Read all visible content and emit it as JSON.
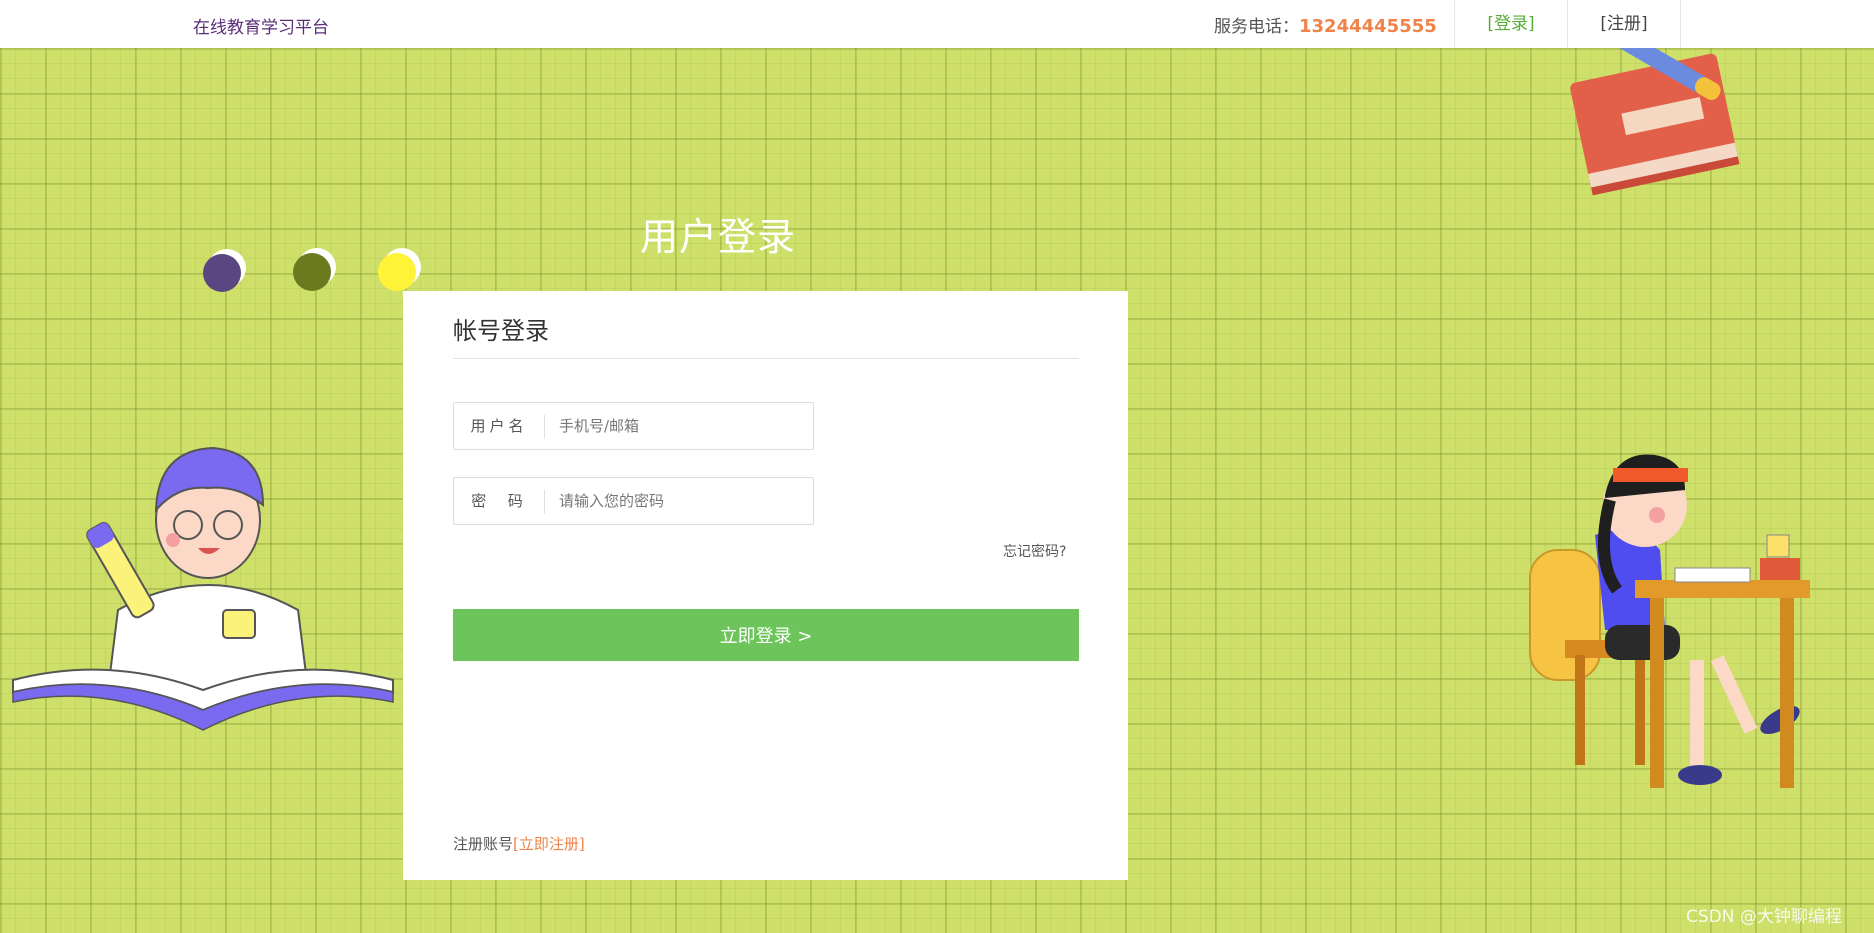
{
  "header": {
    "brand": "在线教育学习平台",
    "service_label": "服务电话：",
    "phone": "13244445555",
    "nav_login": "[登录]",
    "nav_register": "[注册]"
  },
  "page_title": "用户登录",
  "login_card": {
    "title": "帐号登录",
    "username_label": "用户名",
    "username_placeholder": "手机号/邮箱",
    "username_value": "",
    "password_label": "密  码",
    "password_placeholder": "请输入您的密码",
    "password_value": "",
    "forgot_label": "忘记密码?",
    "submit_label": "立即登录 >",
    "register_prefix": "注册账号",
    "register_link": "[立即注册]"
  },
  "watermark": "CSDN @大钟聊编程",
  "colors": {
    "background": "#cfe06a",
    "accent_green": "#6cc45a",
    "phone_orange": "#f0834a",
    "brand_purple": "#5b2d7a"
  },
  "icons": [
    "book-pencil-illustration",
    "boy-reading-illustration",
    "girl-studying-illustration"
  ]
}
